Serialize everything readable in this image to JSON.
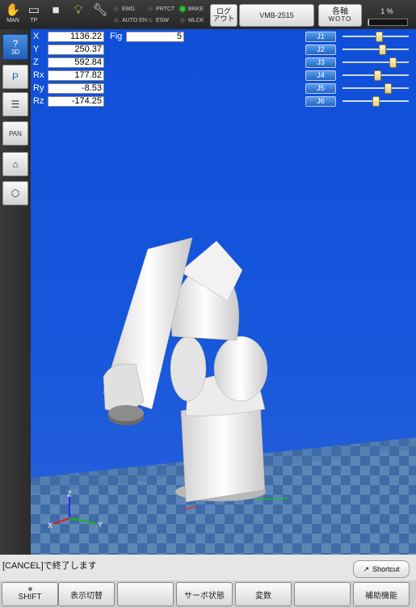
{
  "topbar": {
    "mode_label": "MAN",
    "tp_label": "TP",
    "status": {
      "emg": "EMG",
      "auto_en": "AUTO EN",
      "prtct": "PRTCT",
      "esw": "ESW",
      "brke": "BRKE",
      "mlck": "MLCK"
    },
    "logout_label_1": "ログ",
    "logout_label_2": "アウト",
    "model": "VMB-2515",
    "axis_label_1": "各軸",
    "axis_label_2": "WOTO",
    "speed": "1 %",
    "speed_fraction": 0.02
  },
  "lefttoolbar": {
    "btn_3d": "3D",
    "btn_pan": "PAN"
  },
  "coords": [
    {
      "label": "X",
      "value": "1136.22"
    },
    {
      "label": "Y",
      "value": "250.37"
    },
    {
      "label": "Z",
      "value": "592.84"
    },
    {
      "label": "Rx",
      "value": "177.82"
    },
    {
      "label": "Ry",
      "value": "-8.53"
    },
    {
      "label": "Rz",
      "value": "-174.25"
    }
  ],
  "fig": {
    "label": "Fig",
    "value": "5"
  },
  "joints": [
    {
      "label": "J1",
      "level": 0.55
    },
    {
      "label": "J2",
      "level": 0.6
    },
    {
      "label": "J3",
      "level": 0.75
    },
    {
      "label": "J4",
      "level": 0.52
    },
    {
      "label": "J5",
      "level": 0.68
    },
    {
      "label": "J6",
      "level": 0.5
    }
  ],
  "axes_labels": {
    "x": "X",
    "y": "Y",
    "z": "Z"
  },
  "message": "[CANCEL]で終了します",
  "shortcut_label": "Shortcut",
  "fkeys": [
    "SHIFT",
    "表示切替",
    "",
    "サーボ状態",
    "変数",
    "",
    "補助機能"
  ],
  "colors": {
    "sky": "#1757dc",
    "floor_light": "#5d86b8",
    "floor_dark": "#3f6ca6",
    "robot": "#f3f3f3",
    "accent": "#2467c4"
  }
}
